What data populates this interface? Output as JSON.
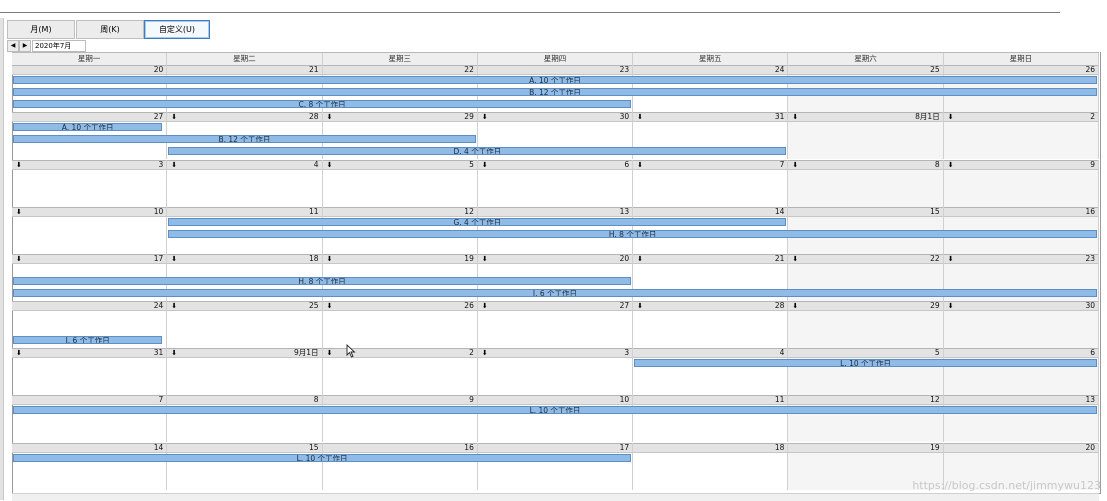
{
  "toolbar": {
    "month_label": "月(M)",
    "week_label": "周(K)",
    "custom_label": "自定义(U)"
  },
  "nav": {
    "prev_icon": "◀",
    "next_icon": "▶",
    "date_value": "2020年7月"
  },
  "weekdays": [
    "星期一",
    "星期二",
    "星期三",
    "星期四",
    "星期五",
    "星期六",
    "星期日"
  ],
  "marker_icon": "⬇",
  "weeks": [
    {
      "days": [
        "20",
        "21",
        "22",
        "23",
        "24",
        "25",
        "26"
      ],
      "markers": [
        false,
        false,
        false,
        false,
        false,
        false,
        false
      ],
      "tasks": [
        {
          "label": "A. 10 个工作日",
          "start": 0,
          "span": 7,
          "lane": 0
        },
        {
          "label": "B. 12 个工作日",
          "start": 0,
          "span": 7,
          "lane": 1
        },
        {
          "label": "C. 8 个工作日",
          "start": 0,
          "span": 4,
          "lane": 2
        }
      ]
    },
    {
      "days": [
        "27",
        "28",
        "29",
        "30",
        "31",
        "8月1日",
        "2"
      ],
      "markers": [
        false,
        true,
        true,
        true,
        true,
        true,
        true
      ],
      "tasks": [
        {
          "label": "A. 10 个工作日",
          "start": 0,
          "span": 1,
          "lane": 0
        },
        {
          "label": "B. 12 个工作日",
          "start": 0,
          "span": 3,
          "lane": 1
        },
        {
          "label": "D. 4 个工作日",
          "start": 1,
          "span": 4,
          "lane": 2
        }
      ]
    },
    {
      "days": [
        "3",
        "4",
        "5",
        "6",
        "7",
        "8",
        "9"
      ],
      "markers": [
        true,
        true,
        true,
        true,
        true,
        true,
        true
      ],
      "tasks": []
    },
    {
      "days": [
        "10",
        "11",
        "12",
        "13",
        "14",
        "15",
        "16"
      ],
      "markers": [
        true,
        false,
        false,
        false,
        false,
        false,
        false
      ],
      "tasks": [
        {
          "label": "G. 4 个工作日",
          "start": 1,
          "span": 4,
          "lane": 0
        },
        {
          "label": "H. 8 个工作日",
          "start": 1,
          "span": 6,
          "lane": 1
        }
      ]
    },
    {
      "days": [
        "17",
        "18",
        "19",
        "20",
        "21",
        "22",
        "23"
      ],
      "markers": [
        true,
        true,
        true,
        true,
        true,
        true,
        true
      ],
      "tasks": [
        {
          "label": "H. 8 个工作日",
          "start": 0,
          "span": 4,
          "lane": 1
        },
        {
          "label": "I. 6 个工作日",
          "start": 0,
          "span": 7,
          "lane": 2
        }
      ]
    },
    {
      "days": [
        "24",
        "25",
        "26",
        "27",
        "28",
        "29",
        "30"
      ],
      "markers": [
        false,
        true,
        true,
        true,
        true,
        true,
        true
      ],
      "tasks": [
        {
          "label": "I. 6 个工作日",
          "start": 0,
          "span": 1,
          "lane": 2
        }
      ]
    },
    {
      "days": [
        "31",
        "9月1日",
        "2",
        "3",
        "4",
        "5",
        "6"
      ],
      "markers": [
        true,
        true,
        true,
        true,
        false,
        false,
        false
      ],
      "tasks": [
        {
          "label": "L. 10 个工作日",
          "start": 4,
          "span": 3,
          "lane": 0
        }
      ]
    },
    {
      "days": [
        "7",
        "8",
        "9",
        "10",
        "11",
        "12",
        "13"
      ],
      "markers": [
        false,
        false,
        false,
        false,
        false,
        false,
        false
      ],
      "tasks": [
        {
          "label": "L. 10 个工作日",
          "start": 0,
          "span": 7,
          "lane": 0
        }
      ]
    },
    {
      "days": [
        "14",
        "15",
        "16",
        "17",
        "18",
        "19",
        "20"
      ],
      "markers": [
        false,
        false,
        false,
        false,
        false,
        false,
        false
      ],
      "tasks": [
        {
          "label": "L. 10 个工作日",
          "start": 0,
          "span": 4,
          "lane": 0
        }
      ]
    }
  ],
  "watermark": "https://blog.csdn.net/jimmywu123"
}
